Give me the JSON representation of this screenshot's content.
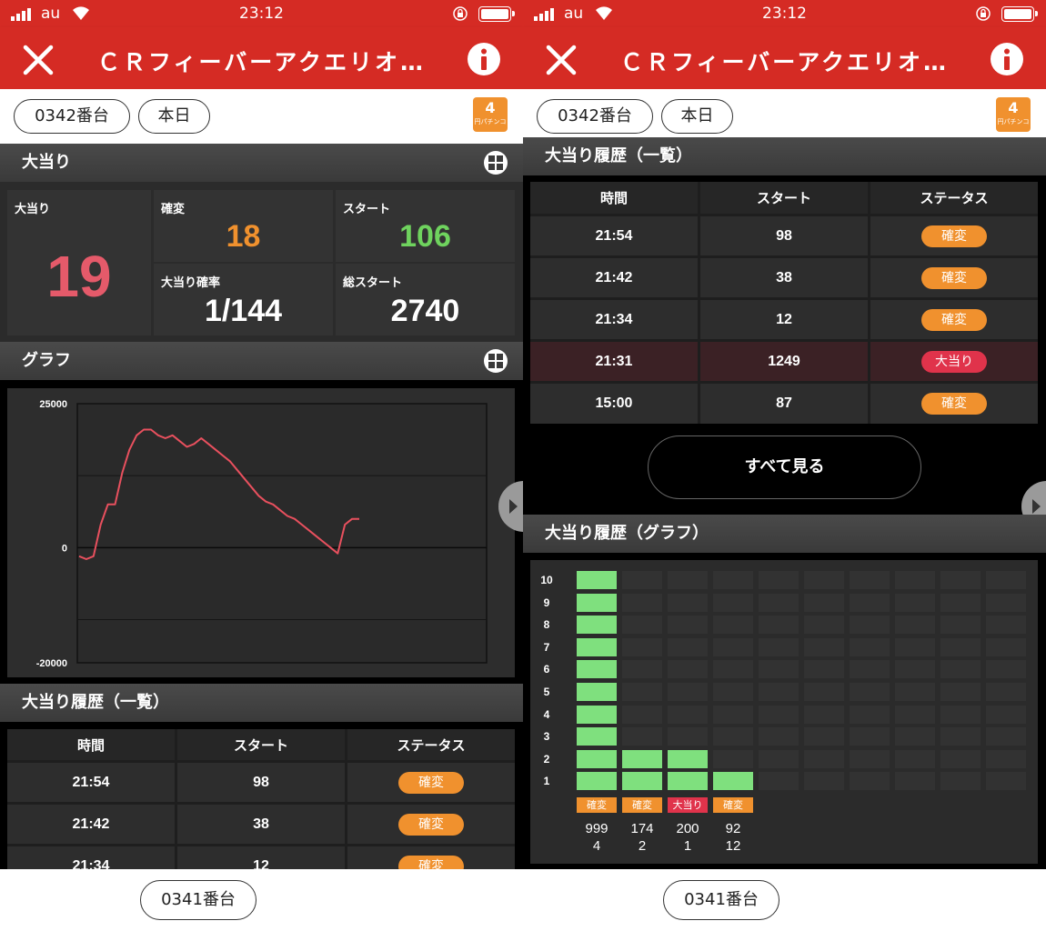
{
  "status_bar": {
    "carrier": "au",
    "time": "23:12"
  },
  "nav": {
    "title": "ＣＲフィーバーアクエリオ…"
  },
  "pills": {
    "machine": "0342番台",
    "day": "本日",
    "rate_badge_number": "4",
    "rate_badge_text": "円パチンコ"
  },
  "colors": {
    "brand_red": "#d52b24",
    "orange": "#f0912e",
    "green": "#7fe07e",
    "hit_red": "#e55a6a",
    "probability_green": "#6fd35e"
  },
  "stats": {
    "section_title": "大当り",
    "jackpot_label": "大当り",
    "jackpot_value": "19",
    "kakuhen_label": "確変",
    "kakuhen_value": "18",
    "start_label": "スタート",
    "start_value": "106",
    "prob_label": "大当り確率",
    "prob_value": "1/144",
    "total_start_label": "総スタート",
    "total_start_value": "2740"
  },
  "graph": {
    "section_title": "グラフ",
    "chart_data": {
      "type": "line",
      "yticks": [
        "25000",
        "0",
        "-20000"
      ],
      "ylim": [
        -20000,
        25000
      ],
      "values": [
        -1500,
        -2000,
        -1500,
        4000,
        7500,
        7500,
        13000,
        17000,
        19500,
        20500,
        20500,
        19500,
        19000,
        19500,
        18500,
        17500,
        18000,
        19000,
        18000,
        17000,
        16000,
        15000,
        13500,
        12000,
        10500,
        9000,
        8000,
        7500,
        6500,
        5500,
        5000,
        4000,
        3000,
        2000,
        1000,
        0,
        -1000,
        4000,
        5000,
        5000
      ]
    }
  },
  "history_list": {
    "section_title": "大当り履歴（一覧）",
    "headers": [
      "時間",
      "スタート",
      "ステータス"
    ],
    "rows": [
      {
        "time": "21:54",
        "start": "98",
        "status": "確変"
      },
      {
        "time": "21:42",
        "start": "38",
        "status": "確変"
      },
      {
        "time": "21:34",
        "start": "12",
        "status": "確変"
      },
      {
        "time": "21:31",
        "start": "1249",
        "status": "大当り"
      },
      {
        "time": "15:00",
        "start": "87",
        "status": "確変"
      }
    ],
    "see_all": "すべて見る"
  },
  "history_graph": {
    "section_title": "大当り履歴（グラフ）",
    "chart_data": {
      "type": "bar",
      "y_labels": [
        "10",
        "9",
        "8",
        "7",
        "6",
        "5",
        "4",
        "3",
        "2",
        "1"
      ],
      "ylim": [
        0,
        10
      ],
      "bars": [
        {
          "value": 10,
          "status": "確変",
          "start": "999",
          "count": "4"
        },
        {
          "value": 2,
          "status": "確変",
          "start": "174",
          "count": "2"
        },
        {
          "value": 2,
          "status": "大当り",
          "start": "200",
          "count": "1"
        },
        {
          "value": 1,
          "status": "確変",
          "start": "92",
          "count": "12"
        }
      ]
    }
  },
  "bottom": {
    "prev_machine": "0341番台"
  }
}
